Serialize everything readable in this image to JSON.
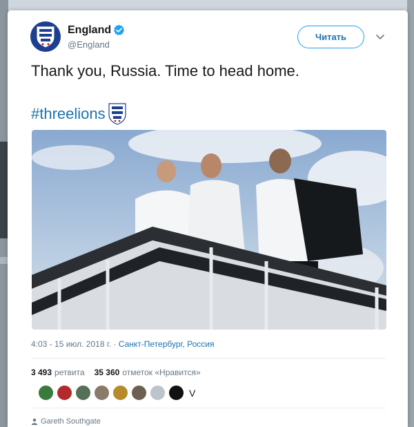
{
  "tweet": {
    "user_name": "England",
    "handle": "@England",
    "follow_label": "Читать",
    "text": "Thank you, Russia. Time to head home.",
    "hashtag": "#threelions",
    "meta_time": "4:03 - 15 июл. 2018 г.",
    "meta_location": "Санкт-Петербург, Россия",
    "retweet_count": "3 493",
    "retweet_label": "ретвита",
    "like_count": "35 360",
    "like_label": "отметок «Нравится»",
    "author_attribution": "Gareth Southgate"
  },
  "colors": {
    "link": "#1b73ae",
    "brand_blue": "#1d3f8f",
    "text_primary": "#14171a",
    "text_secondary": "#657786"
  },
  "icons": [
    "verified-icon",
    "caret-down-icon",
    "three-lions-crest-icon",
    "person-icon"
  ]
}
